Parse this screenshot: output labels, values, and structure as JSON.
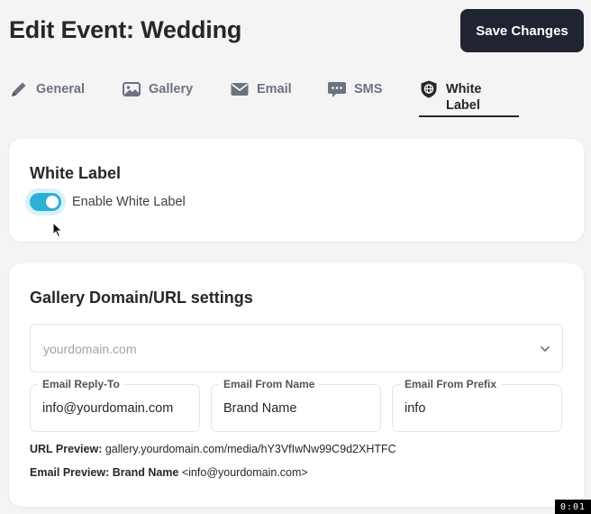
{
  "header": {
    "title": "Edit Event: Wedding",
    "save_label": "Save Changes"
  },
  "tabs": [
    {
      "label": "General",
      "icon": "pencil-icon",
      "active": false
    },
    {
      "label": "Gallery",
      "icon": "image-icon",
      "active": false
    },
    {
      "label": "Email",
      "icon": "envelope-icon",
      "active": false
    },
    {
      "label": "SMS",
      "icon": "chat-bubble-icon",
      "active": false
    },
    {
      "label": "White Label",
      "icon": "globe-shield-icon",
      "active": true
    }
  ],
  "white_label": {
    "title": "White Label",
    "toggle_label": "Enable White Label",
    "enabled": true
  },
  "domain_settings": {
    "title": "Gallery Domain/URL settings",
    "domain_placeholder": "yourdomain.com",
    "fields": [
      {
        "label": "Email Reply-To",
        "value": "info@yourdomain.com"
      },
      {
        "label": "Email From Name",
        "value": "Brand Name"
      },
      {
        "label": "Email From Prefix",
        "value": "info"
      }
    ],
    "url_preview_label": "URL Preview:",
    "url_preview_value": "gallery.yourdomain.com/media/hY3VfIwNw99C9d2XHTFC",
    "email_preview_label": "Email Preview:",
    "email_preview_name": "Brand Name",
    "email_preview_address": "<info@yourdomain.com>"
  },
  "timer": "0:01",
  "colors": {
    "accent": "#2ab0d6",
    "primary_button": "#1f2430",
    "background": "#f4f4f5"
  }
}
